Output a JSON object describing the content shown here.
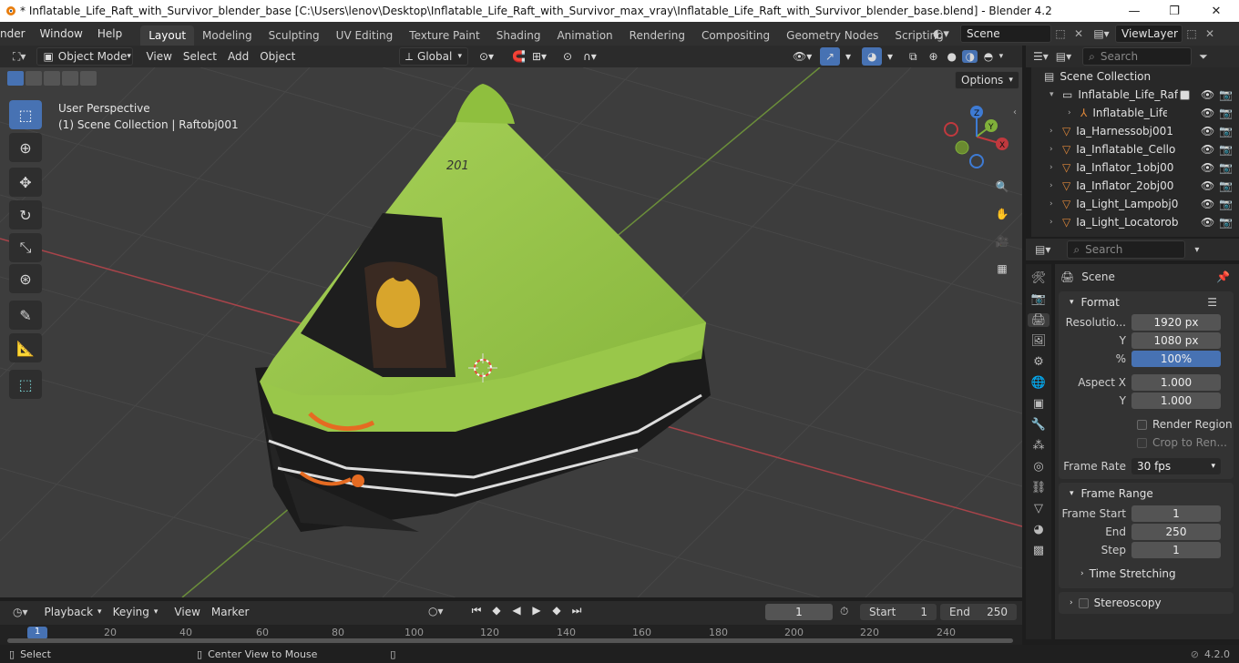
{
  "window": {
    "title": "* Inflatable_Life_Raft_with_Survivor_blender_base [C:\\Users\\lenov\\Desktop\\Inflatable_Life_Raft_with_Survivor_max_vray\\Inflatable_Life_Raft_with_Survivor_blender_base.blend] - Blender 4.2",
    "min": "—",
    "max": "❐",
    "close": "✕"
  },
  "menu": [
    "nder",
    "Window",
    "Help"
  ],
  "workspaces": [
    "Layout",
    "Modeling",
    "Sculpting",
    "UV Editing",
    "Texture Paint",
    "Shading",
    "Animation",
    "Rendering",
    "Compositing",
    "Geometry Nodes",
    "Scripting"
  ],
  "active_workspace": "Layout",
  "scene_field": "Scene",
  "viewlayer_field": "ViewLayer",
  "viewport_header": {
    "mode": "Object Mode",
    "menus": [
      "View",
      "Select",
      "Add",
      "Object"
    ],
    "transform_orientation": "Global",
    "options": "Options"
  },
  "viewport_overlay": {
    "line1": "User Perspective",
    "line2": "(1) Scene Collection | Raftobj001"
  },
  "outliner": {
    "search_placeholder": "Search",
    "root": "Scene Collection",
    "items": [
      "Inflatable_Life_Raft",
      "Inflatable_Life_",
      "Ia_Harnessobj001",
      "Ia_Inflatable_Cello",
      "Ia_Inflator_1obj00",
      "Ia_Inflator_2obj00",
      "Ia_Light_Lampobj0",
      "Ia_Light_Locatorob"
    ]
  },
  "properties": {
    "search_placeholder": "Search",
    "context": "Scene",
    "format": {
      "title": "Format",
      "res_label": "Resolutio...",
      "res_x": "1920 px",
      "y_label": "Y",
      "res_y": "1080 px",
      "pct_label": "%",
      "pct": "100%",
      "aspect_label": "Aspect X",
      "aspect_x": "1.000",
      "aspect_y": "1.000",
      "render_region": "Render Region",
      "crop": "Crop to Ren...",
      "frame_rate_label": "Frame Rate",
      "frame_rate": "30 fps"
    },
    "frame_range": {
      "title": "Frame Range",
      "start_label": "Frame Start",
      "start": "1",
      "end_label": "End",
      "end": "250",
      "step_label": "Step",
      "step": "1",
      "time_stretching": "Time Stretching"
    },
    "stereoscopy": "Stereoscopy"
  },
  "timeline": {
    "menus": [
      "Playback",
      "Keying",
      "View",
      "Marker"
    ],
    "current_frame": "1",
    "start_label": "Start",
    "start": "1",
    "end_label": "End",
    "end": "250",
    "ruler": [
      "1",
      "20",
      "40",
      "60",
      "80",
      "100",
      "120",
      "140",
      "160",
      "180",
      "200",
      "220",
      "240"
    ]
  },
  "statusbar": {
    "select": "Select",
    "center": "Center View to Mouse",
    "version": "4.2.0"
  },
  "model_text": "201",
  "colors": {
    "accent": "#4772b3",
    "raft_green": "#9ac74a",
    "raft_black": "#1b1b1b",
    "x_axis": "#c0393e",
    "y_axis": "#80b03a"
  }
}
